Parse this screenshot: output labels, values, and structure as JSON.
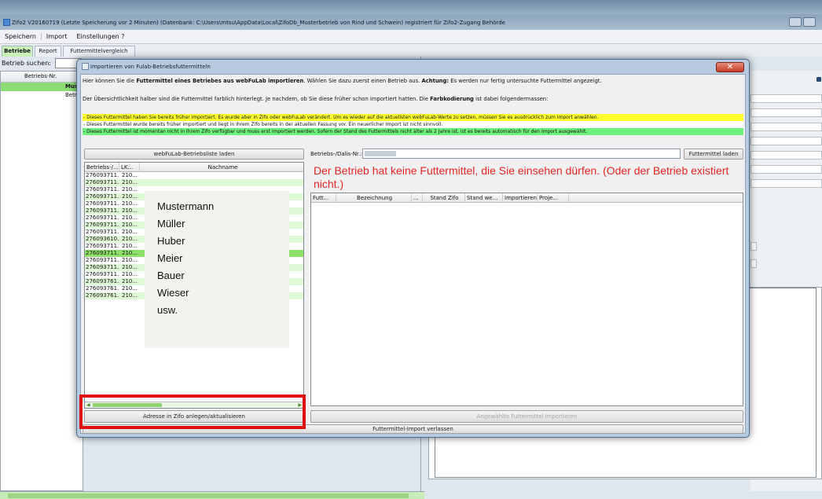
{
  "app": {
    "title": "Zifo2 V20160719 (Letzte Speicherung vor 2 Minuten) (Datenbank: C:\\Users\\mtsu\\AppData\\Local\\ZifoDb_Musterbetrieb von Rind und Schwein) registriert für Zifo2-Zugang Behörde",
    "menu": [
      "Speichern",
      "Import",
      "Einstellungen ?"
    ],
    "tabs": [
      "Betriebe",
      "Report",
      "Futtermittelvergleich"
    ],
    "search_label": "Betrieb suchen:",
    "left_list_header": "Betriebs-Nr.",
    "left_list_rows": [
      "Mus",
      "Betr"
    ]
  },
  "dialog": {
    "title": "Importieren von Fulab-Betriebsfuttermitteln",
    "close_label": "✕",
    "intro_pre": "Hier können Sie die ",
    "intro_bold": "Futtermittel eines Betriebes aus webFuLab importieren",
    "intro_mid": ". Wählen Sie dazu zuerst einen Betrieb aus. ",
    "intro_bold2": "Achtung:",
    "intro_post": " Es werden nur fertig untersuchte Futtermittel angezeigt.",
    "overview_pre": "Der Übersichtlichkeit halber sind die Futtermittel farblich hinterlegt. Je nachdem, ob Sie diese früher schon importiert hatten. Die ",
    "overview_bold": "Farbkodierung",
    "overview_post": " ist dabei folgendermassen:",
    "legend": [
      {
        "text": "- Dieses Futtermittel haben Sie bereits früher importiert. Es wurde aber in Zifo oder webFuLab verändert. Um es wieder auf die aktuellsten webFuLab-Werte zu setzen, müssen Sie es ausdrücklich zum Import anwählen.",
        "color": "#ffff2e"
      },
      {
        "text": "- Dieses Futtermittel wurde bereits früher importiert und liegt in Ihrem Zifo bereits in der aktuellen Fassung vor. Ein neuerlicher Import ist nicht sinnvoll.",
        "color": "#ffffff"
      },
      {
        "text": "- Dieses Futtermittel ist momentan nicht in Ihrem Zifo verfügbar und muss erst importiert werden. Sofern der Stand des Futtermittels nicht älter als 2 Jahre ist, ist es bereits automatisch für den Import ausgewählt.",
        "color": "#6ef27c"
      }
    ],
    "load_list_button": "webFuLab-Betriebsliste laden",
    "list_columns": [
      "Betriebs-/...",
      "LK...",
      "Nachname"
    ],
    "list_rows": [
      {
        "nr": "276093711...",
        "lk": "210..."
      },
      {
        "nr": "276093711...",
        "lk": "210..."
      },
      {
        "nr": "276093711...",
        "lk": "210..."
      },
      {
        "nr": "276093711...",
        "lk": "210..."
      },
      {
        "nr": "276093711...",
        "lk": "210..."
      },
      {
        "nr": "276093711...",
        "lk": "210..."
      },
      {
        "nr": "276093711...",
        "lk": "210..."
      },
      {
        "nr": "276093711...",
        "lk": "210..."
      },
      {
        "nr": "276093711...",
        "lk": "210..."
      },
      {
        "nr": "276093610...",
        "lk": "210..."
      },
      {
        "nr": "276093711...",
        "lk": "210..."
      },
      {
        "nr": "276093711...",
        "lk": "210..."
      },
      {
        "nr": "276093711...",
        "lk": "210..."
      },
      {
        "nr": "276093711...",
        "lk": "210..."
      },
      {
        "nr": "276093711...",
        "lk": "210..."
      },
      {
        "nr": "276093761...",
        "lk": "210..."
      },
      {
        "nr": "276093761...",
        "lk": "210..."
      },
      {
        "nr": "276093761...",
        "lk": "210..."
      }
    ],
    "names": [
      "Mustermann",
      "Müller",
      "Huber",
      "Meier",
      "Bauer",
      "Wieser",
      "usw."
    ],
    "address_button": "Adresse in Zifo anlegen/aktualisieren",
    "betrieb_label": "Betriebs-/Dalis-Nr.:",
    "betrieb_value": "",
    "load_feed_button": "Futtermittel laden",
    "no_feed_message": "Der Betrieb hat keine Futtermittel, die Sie einsehen dürfen. (Oder der Betrieb existiert nicht.)",
    "feed_columns": [
      "Futt...",
      "Bezeichnung",
      "...",
      "Stand Zifo",
      "Stand we...",
      "Importieren",
      "Proje..."
    ],
    "import_selected_button": "Angewählte Futtermittel importieren",
    "exit_button": "Futtermittel-Import verlassen"
  }
}
